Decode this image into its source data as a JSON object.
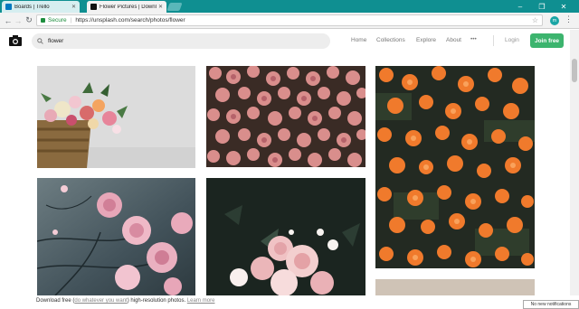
{
  "browser": {
    "tabs": [
      {
        "title": "Boards | Trello",
        "active": false
      },
      {
        "title": "Flower Pictures | Downl",
        "active": true
      }
    ],
    "address": {
      "secure_label": "Secure",
      "url": "https://unsplash.com/search/photos/flower"
    },
    "extension_badge": "m"
  },
  "header": {
    "search_value": "flower",
    "nav": [
      "Home",
      "Collections",
      "Explore",
      "About",
      "•••"
    ],
    "login_label": "Login",
    "join_label": "Join free"
  },
  "footer": {
    "text_before": "Download free (",
    "link1": "do whatever you want",
    "text_after": ") high-resolution photos. ",
    "link2": "Learn more"
  },
  "toast": "No new notifications",
  "colors": {
    "brand_green": "#3cb46e",
    "chrome_teal": "#0f8f91"
  }
}
